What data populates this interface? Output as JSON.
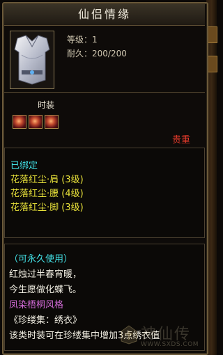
{
  "title": "仙侣情缘",
  "item": {
    "icon": "silver-armor-icon",
    "level_label": "等级：1",
    "durability_label": "耐久：200/200"
  },
  "fashion": {
    "label": "时装",
    "slots": [
      "gem-slot-icon",
      "gem-slot-icon",
      "gem-slot-icon"
    ]
  },
  "rarity": {
    "label": "贵重",
    "color": "#e23a2a"
  },
  "binding": {
    "status": "已绑定",
    "set_items": [
      "花落红尘·肩 (3级)",
      "花落红尘·腰 (4级)",
      "花落红尘·脚 (3级)"
    ]
  },
  "description": {
    "usage": "（可永久使用）",
    "poem_lines": [
      "红烛过半春宵暖，",
      "今生愿做化蝶飞。"
    ],
    "style": "凤染梧桐风格",
    "collection": "《珍缕集：绣衣》",
    "effect": "该类时装可在珍缕集中增加3点绣衣值"
  },
  "watermark": {
    "text": "神仙传",
    "url": "WWW.SXDS.COM"
  },
  "colors": {
    "cyan": "#43e3e8",
    "yellow": "#e9e23a",
    "purple": "#d46bd8",
    "red": "#e23a2a"
  }
}
